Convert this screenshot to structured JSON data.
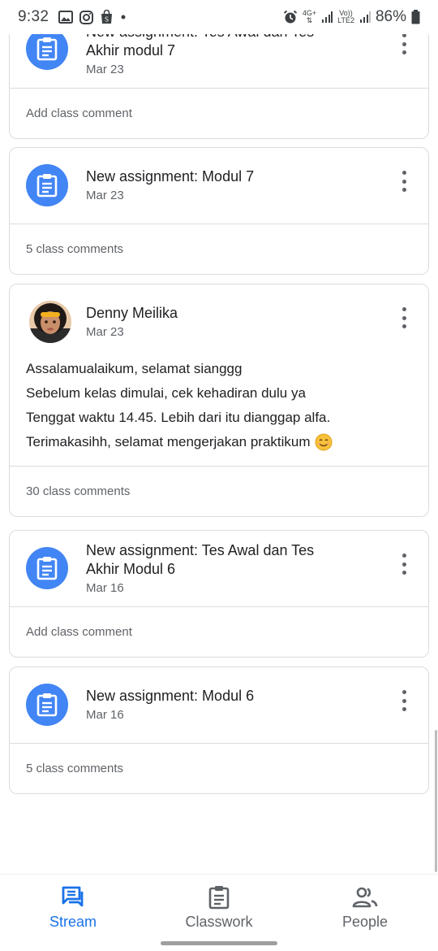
{
  "status_bar": {
    "time": "9:32",
    "network_top": "4G+",
    "network_lte": "Vo))",
    "network_lte2": "LTE2",
    "battery": "86%"
  },
  "posts": [
    {
      "kind": "assignment",
      "title_line1": "New assignment: Tes Awal dan Tes",
      "title_line2": "Akhir modul 7",
      "date": "Mar 23",
      "comment_label": "Add class comment"
    },
    {
      "kind": "assignment",
      "title_line1": "New assignment: Modul 7",
      "date": "Mar 23",
      "comment_label": "5 class comments"
    },
    {
      "kind": "announcement",
      "author": "Denny Meilika",
      "date": "Mar 23",
      "lines": [
        "Assalamualaikum, selamat sianggg",
        "Sebelum kelas dimulai, cek kehadiran dulu ya",
        "Tenggat waktu 14.45. Lebih dari itu dianggap alfa.",
        "Terimakasihh, selamat mengerjakan praktikum"
      ],
      "comment_label": "30 class comments"
    },
    {
      "kind": "assignment",
      "title_line1": "New assignment: Tes Awal dan Tes",
      "title_line2": "Akhir Modul 6",
      "date": "Mar 16",
      "comment_label": "Add class comment"
    },
    {
      "kind": "assignment",
      "title_line1": "New assignment: Modul 6",
      "date": "Mar 16",
      "comment_label": "5 class comments"
    }
  ],
  "bottom_nav": {
    "stream": "Stream",
    "classwork": "Classwork",
    "people": "People"
  },
  "colors": {
    "accent": "#1a73e8",
    "assignment_icon_bg": "#4285f4",
    "border": "#dadce0",
    "secondary_text": "#5f6368"
  }
}
